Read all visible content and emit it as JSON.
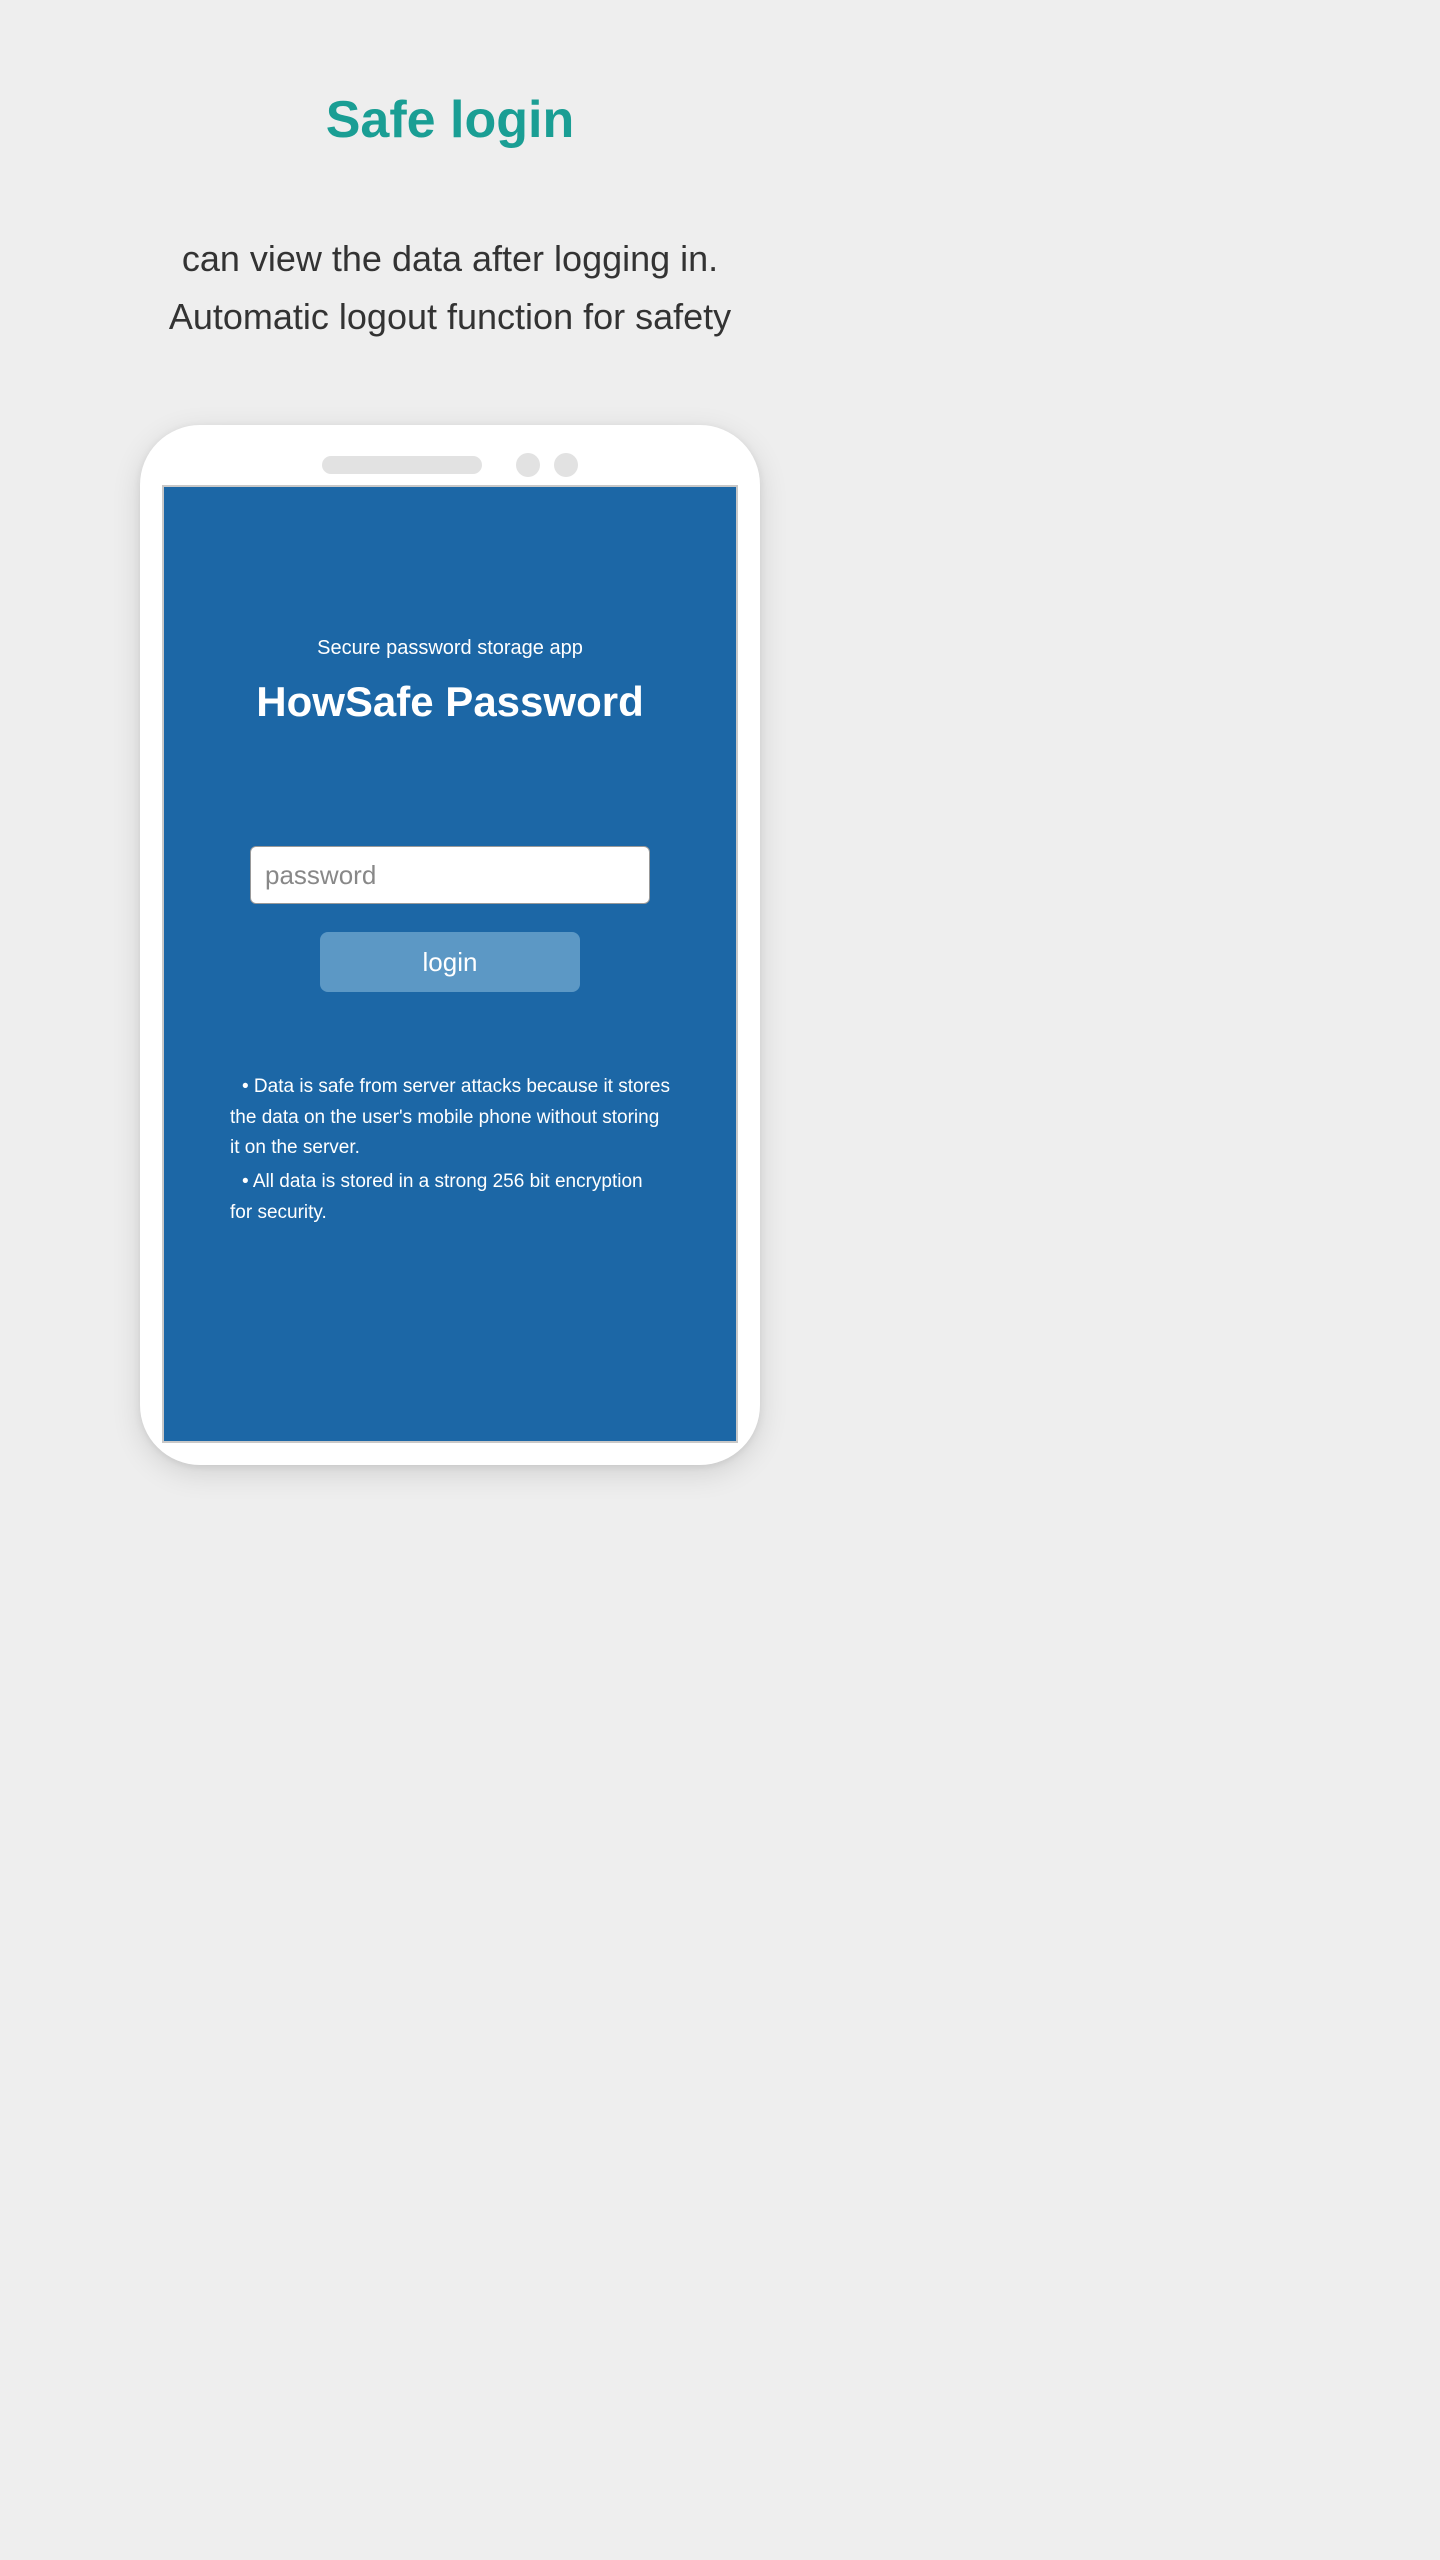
{
  "page": {
    "title": "Safe login",
    "subtitle_line1": "can view the data after logging in.",
    "subtitle_line2": "Automatic logout function for safety"
  },
  "app": {
    "tagline": "Secure password storage app",
    "name": "HowSafe Password"
  },
  "form": {
    "password_placeholder": "password",
    "login_label": "login"
  },
  "bullets": {
    "item1": " • Data is safe from server attacks because it stores the data on the user's mobile phone without storing it on the server.",
    "item2": " • All data is stored in a strong 256 bit encryption for security."
  },
  "colors": {
    "accent": "#1a9e94",
    "screen_bg": "#1c67a6",
    "button_bg": "#5c98c5"
  }
}
